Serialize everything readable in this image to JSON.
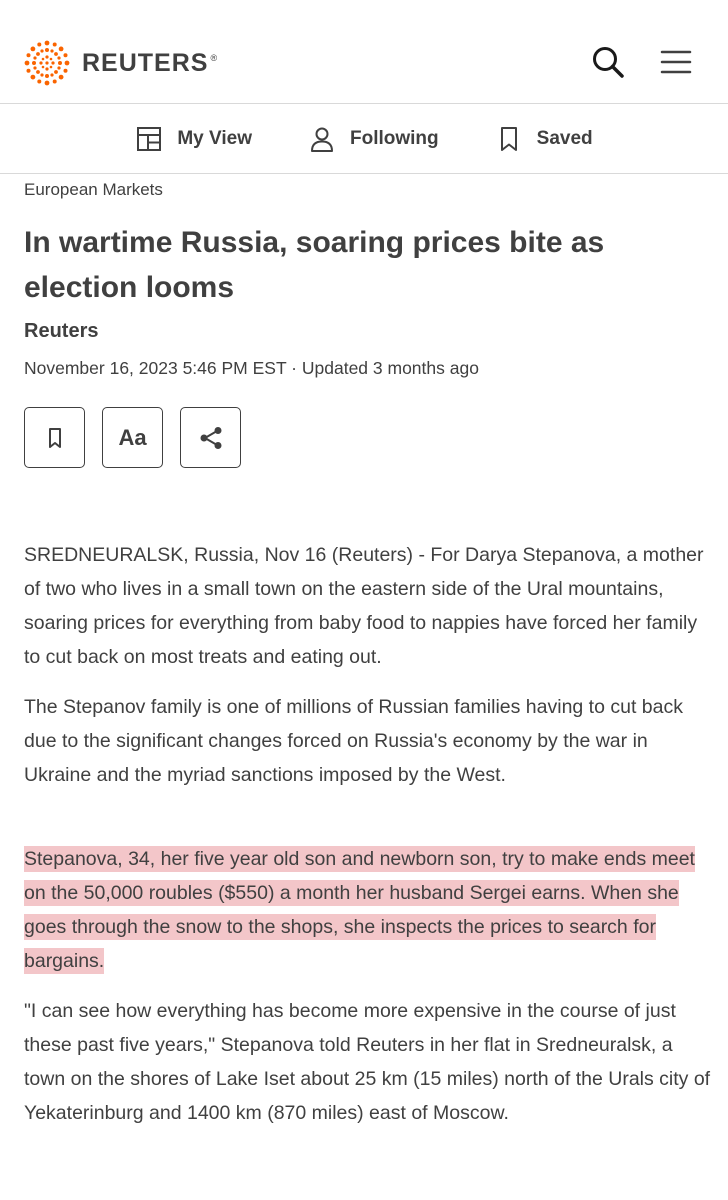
{
  "header": {
    "brand": "REUTERS",
    "registered": "®",
    "search_icon": "search-icon",
    "menu_icon": "hamburger-menu-icon"
  },
  "subnav": {
    "items": [
      {
        "label": "My View",
        "icon": "layout-grid-icon"
      },
      {
        "label": "Following",
        "icon": "user-icon"
      },
      {
        "label": "Saved",
        "icon": "bookmark-icon"
      }
    ]
  },
  "article": {
    "section": "European Markets",
    "title": "In wartime Russia, soaring prices bite as election looms",
    "byline": "Reuters",
    "dateline": "November 16, 2023 5:46 PM EST · Updated 3 months ago",
    "tools": {
      "bookmark_icon": "bookmark-icon",
      "text_size_label": "Aa",
      "share_icon": "share-icon"
    },
    "paragraphs": [
      "SREDNEURALSK, Russia, Nov 16 (Reuters) - For Darya Stepanova, a mother of two who lives in a small town on the eastern side of the Ural mountains, soaring prices for everything from baby food to nappies have forced her family to cut back on most treats and eating out.",
      "The Stepanov family is one of millions of Russian families having to cut back due to the significant changes forced on Russia's economy by the war in Ukraine and the myriad sanctions imposed by the West.",
      "Stepanova, 34, her five year old son and newborn son, try to make ends meet on the 50,000 roubles ($550) a month her husband Sergei earns. When she goes through the snow to the shops, she inspects the prices to search for bargains.",
      "\"I can see how everything has become more expensive in the course of just these past five years,\" Stepanova told Reuters in her flat in Sredneuralsk, a town on the shores of Lake Iset about 25 km (15 miles) north of the Urals city of Yekaterinburg and 1400 km (870 miles) east of Moscow."
    ],
    "highlight_color": "#f3c6c9"
  },
  "colors": {
    "brand_orange": "#fa6400",
    "text": "#404040",
    "divider": "#d9d9d9"
  }
}
